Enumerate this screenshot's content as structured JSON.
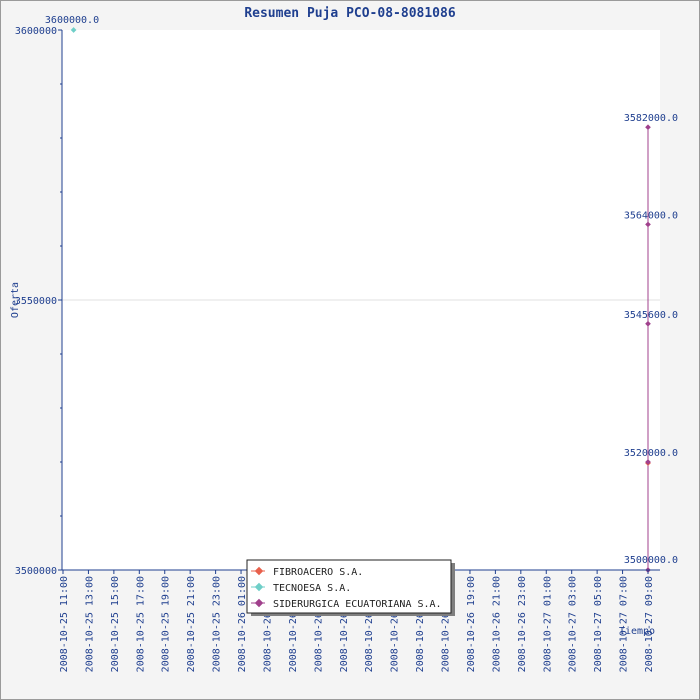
{
  "chart_data": {
    "type": "line",
    "title": "Resumen Puja PCO-08-8081086",
    "xlabel": "Tiempo",
    "ylabel": "Oferta",
    "ylim": [
      3500000,
      3600000
    ],
    "y_ticks": [
      "3600000",
      "3550000",
      "3500000"
    ],
    "x_ticks": [
      "2008-10-25 11:00",
      "2008-10-25 13:00",
      "2008-10-25 15:00",
      "2008-10-25 17:00",
      "2008-10-25 19:00",
      "2008-10-25 21:00",
      "2008-10-25 23:00",
      "2008-10-26 01:00",
      "2008-10-26 03:00",
      "2008-10-26 05:00",
      "2008-10-26 07:00",
      "2008-10-26 09:00",
      "2008-10-26 11:00",
      "2008-10-26 13:00",
      "2008-10-26 15:00",
      "2008-10-26 17:00",
      "2008-10-26 19:00",
      "2008-10-26 21:00",
      "2008-10-26 23:00",
      "2008-10-27 01:00",
      "2008-10-27 03:00",
      "2008-10-27 05:00",
      "2008-10-27 07:00",
      "2008-10-27 09:00"
    ],
    "grid": true,
    "legend_position": "bottom-center",
    "series": [
      {
        "name": "FIBROACERO S.A.",
        "color": "#e8604c",
        "points": [
          {
            "x": "2008-10-27 09:00",
            "y": 3519800
          }
        ]
      },
      {
        "name": "TECNOESA S.A.",
        "color": "#6fcfc8",
        "points": [
          {
            "x": "2008-10-25 11:50",
            "y": 3600000
          }
        ]
      },
      {
        "name": "SIDERURGICA ECUATORIANA S.A.",
        "color": "#a0408c",
        "points": [
          {
            "x": "2008-10-27 09:00",
            "y": 3582000
          },
          {
            "x": "2008-10-27 09:00",
            "y": 3564000
          },
          {
            "x": "2008-10-27 09:00",
            "y": 3545600
          },
          {
            "x": "2008-10-27 09:00",
            "y": 3520000
          },
          {
            "x": "2008-10-27 09:00",
            "y": 3500000
          }
        ]
      }
    ],
    "annotations": [
      {
        "text": "3600000.0",
        "y": 3600000
      },
      {
        "text": "3582000.0",
        "y": 3582000
      },
      {
        "text": "3564000.0",
        "y": 3564000
      },
      {
        "text": "3545600.0",
        "y": 3545600
      },
      {
        "text": "3520000.0",
        "y": 3520000
      },
      {
        "text": "3500000.0",
        "y": 3500000
      }
    ]
  }
}
